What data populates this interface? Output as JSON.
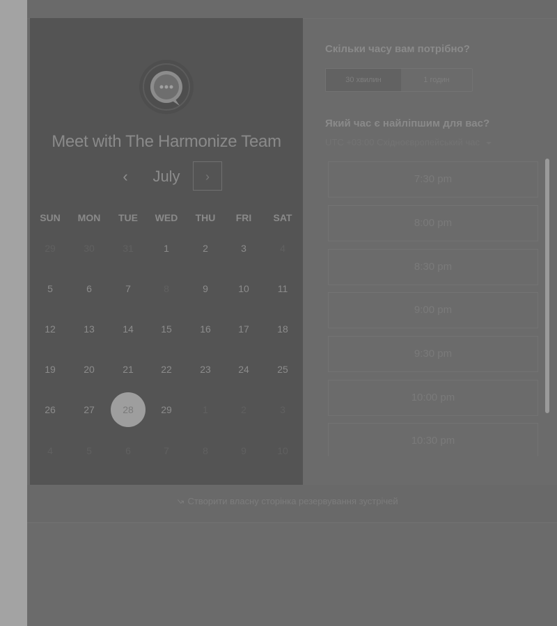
{
  "header": {
    "title": "Meet with The Harmonize Team"
  },
  "calendar": {
    "month": "July",
    "prev_symbol": "‹",
    "next_symbol": "›",
    "weekdays": [
      "SUN",
      "MON",
      "TUE",
      "WED",
      "THU",
      "FRI",
      "SAT"
    ],
    "weeks": [
      [
        "29",
        "30",
        "31",
        "1",
        "2",
        "3",
        "4"
      ],
      [
        "5",
        "6",
        "7",
        "8",
        "9",
        "10",
        "11"
      ],
      [
        "12",
        "13",
        "14",
        "15",
        "16",
        "17",
        "18"
      ],
      [
        "19",
        "20",
        "21",
        "22",
        "23",
        "24",
        "25"
      ],
      [
        "26",
        "27",
        "28",
        "29",
        "1",
        "2",
        "3"
      ],
      [
        "4",
        "5",
        "6",
        "7",
        "8",
        "9",
        "10"
      ]
    ],
    "selected_day": "28"
  },
  "duration": {
    "question": "Скільки часу вам потрібно?",
    "options": [
      "30 хвилин",
      "1 годин"
    ],
    "selected": "30 хвилин"
  },
  "time": {
    "question": "Який час є найліпшим для вас?",
    "timezone": "UTC +03:00 Східноєвропейський час",
    "slots": [
      "7:30 pm",
      "8:00 pm",
      "8:30 pm",
      "9:00 pm",
      "9:30 pm",
      "10:00 pm",
      "10:30 pm"
    ]
  },
  "footer": {
    "link_label": "Створити власну сторінка резервування зустрічей"
  },
  "icons": {
    "logo": "chat-bubble-icon",
    "footer": "arrow-icon",
    "timezone": "caret-down-icon"
  },
  "colors": {
    "overlay_bg": "#6b6b6b",
    "panel_bg": "#545454",
    "selected_day": "#9e9e9e"
  }
}
